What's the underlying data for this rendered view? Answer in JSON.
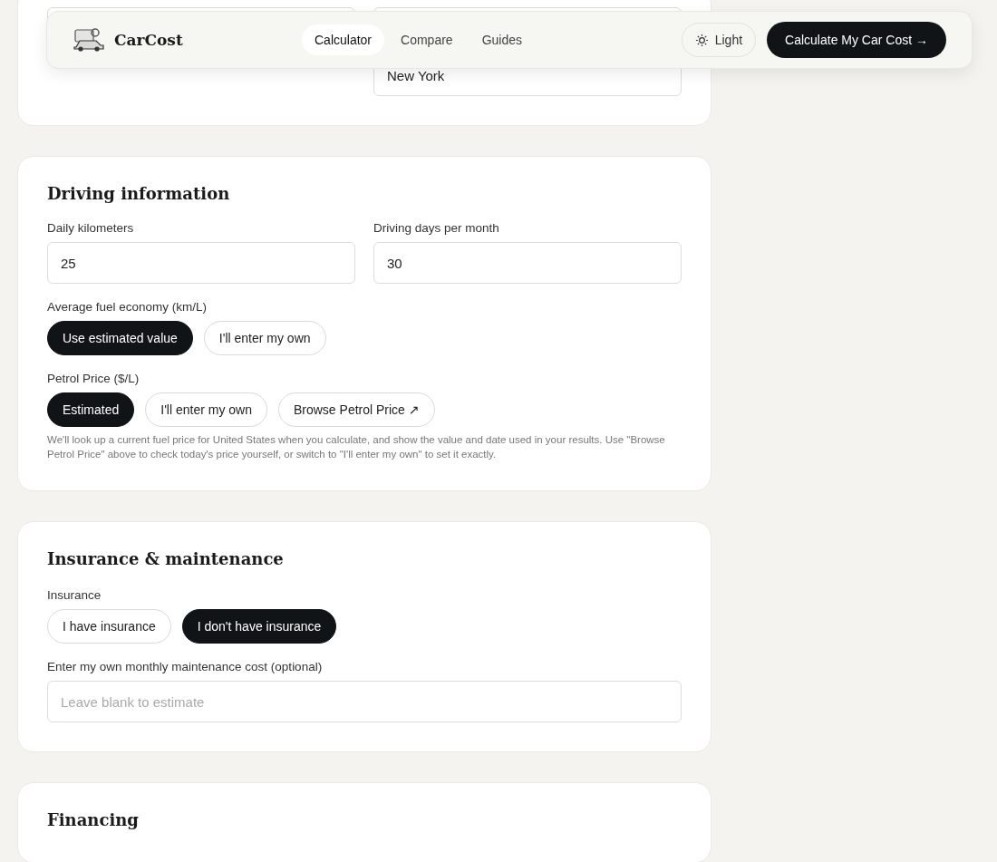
{
  "header": {
    "brand": "CarCost",
    "nav": [
      {
        "label": "Calculator",
        "selected": true
      },
      {
        "label": "Compare",
        "selected": false
      },
      {
        "label": "Guides",
        "selected": false
      }
    ],
    "theme_button": "Light",
    "cta": "Calculate My Car Cost →"
  },
  "location_card": {
    "city_value": "New York"
  },
  "sections": [
    {
      "title": "Driving information",
      "items": [
        {
          "kind": "fields",
          "fields": [
            {
              "label": "Daily kilometers",
              "value": "25"
            },
            {
              "label": "Driving days per month",
              "value": "30"
            }
          ]
        },
        {
          "kind": "choice",
          "label": "Average fuel economy (km/L)",
          "options": [
            {
              "label": "Use estimated value",
              "selected": true
            },
            {
              "label": "I'll enter my own",
              "selected": false
            }
          ]
        },
        {
          "kind": "choice",
          "label": "Petrol Price ($/L)",
          "options": [
            {
              "label": "Estimated",
              "selected": true
            },
            {
              "label": "I'll enter my own",
              "selected": false
            },
            {
              "label": "Browse Petrol Price ↗",
              "selected": false
            }
          ]
        },
        {
          "kind": "note",
          "text": "We'll look up a current fuel price for United States when you calculate, and show the value and date used in your results. Use \"Browse Petrol Price\" above to check today's price yourself, or switch to \"I'll enter my own\" to set it exactly."
        }
      ]
    },
    {
      "title": "Insurance & maintenance",
      "items": [
        {
          "kind": "choice",
          "label": "Insurance",
          "options": [
            {
              "label": "I have insurance",
              "selected": false
            },
            {
              "label": "I don't have insurance",
              "selected": true
            }
          ]
        },
        {
          "kind": "field",
          "label": "Enter my own monthly maintenance cost (optional)",
          "placeholder": "Leave blank to estimate"
        }
      ]
    },
    {
      "title": "Financing"
    }
  ]
}
